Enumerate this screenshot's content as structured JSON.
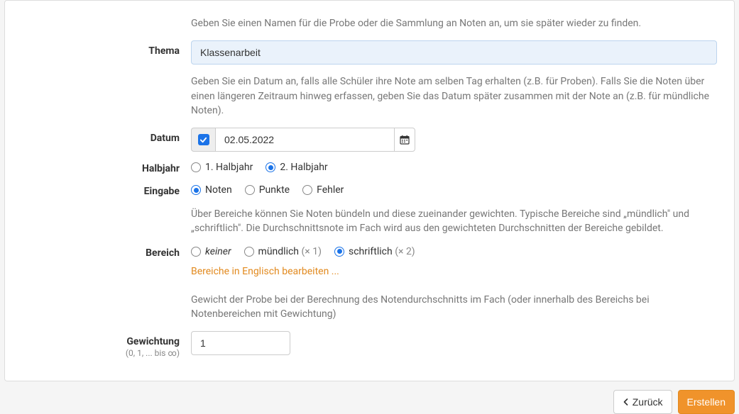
{
  "help": {
    "thema": "Geben Sie einen Namen für die Probe oder die Sammlung an Noten an, um sie später wieder zu finden.",
    "datum": "Geben Sie ein Datum an, falls alle Schüler ihre Note am selben Tag erhalten (z.B. für Proben). Falls Sie die Noten über einen längeren Zeitraum hinweg erfassen, geben Sie das Datum später zusammen mit der Note an (z.B. für mündliche Noten).",
    "bereich": "Über Bereiche können Sie Noten bündeln und diese zueinander gewichten. Typische Bereiche sind „mündlich\" und „schriftlich\". Die Durchschnittsnote im Fach wird aus den gewichteten Durchschnitten der Bereiche gebildet.",
    "gewichtung": "Gewicht der Probe bei der Berechnung des Notendurchschnitts im Fach (oder innerhalb des Bereichs bei Notenbereichen mit Gewichtung)"
  },
  "labels": {
    "thema": "Thema",
    "datum": "Datum",
    "halbjahr": "Halbjahr",
    "eingabe": "Eingabe",
    "bereich": "Bereich",
    "gewichtung": "Gewichtung",
    "gewichtung_sub": "(0, 1, ... bis ∞)"
  },
  "fields": {
    "thema": "Klassenarbeit",
    "datum": "02.05.2022",
    "gewichtung": "1"
  },
  "halbjahr": {
    "opt1": "1. Halbjahr",
    "opt2": "2. Halbjahr"
  },
  "eingabe": {
    "opt1": "Noten",
    "opt2": "Punkte",
    "opt3": "Fehler"
  },
  "bereich": {
    "none_label": "keiner",
    "muendlich_label": "mündlich",
    "muendlich_weight": "(× 1)",
    "schriftlich_label": "schriftlich",
    "schriftlich_weight": "(× 2)",
    "edit_link": "Bereiche in Englisch bearbeiten ..."
  },
  "buttons": {
    "back": "Zurück",
    "submit": "Erstellen"
  }
}
